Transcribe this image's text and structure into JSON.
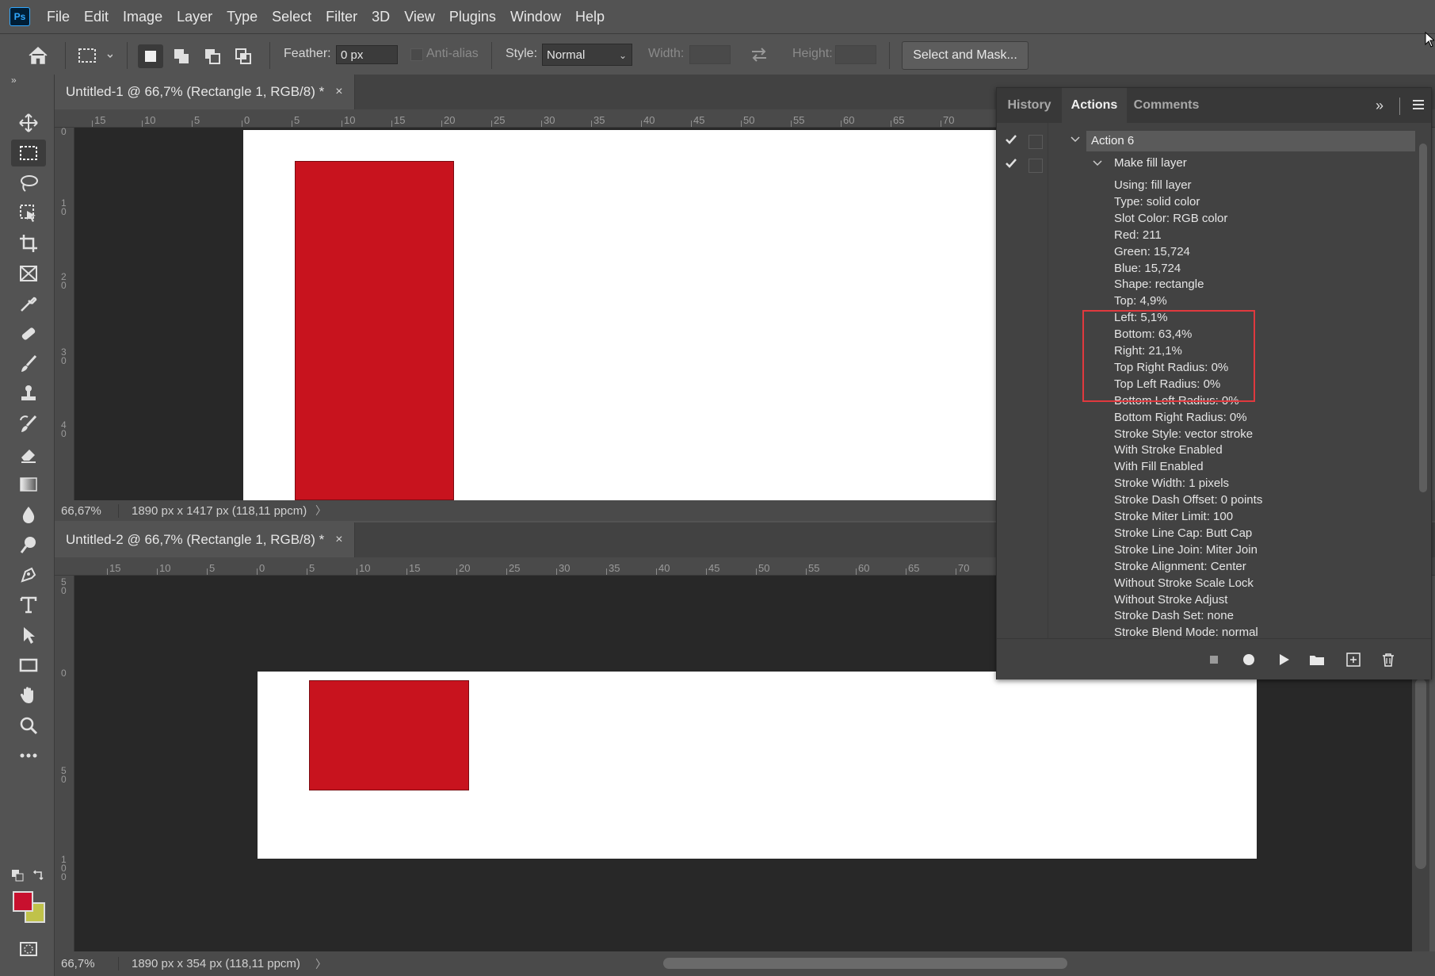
{
  "app": {
    "logo": "Ps"
  },
  "menu": [
    "File",
    "Edit",
    "Image",
    "Layer",
    "Type",
    "Select",
    "Filter",
    "3D",
    "View",
    "Plugins",
    "Window",
    "Help"
  ],
  "options": {
    "feather_label": "Feather:",
    "feather_value": "0 px",
    "antialias_label": "Anti-alias",
    "style_label": "Style:",
    "style_value": "Normal",
    "width_label": "Width:",
    "height_label": "Height:",
    "select_mask_label": "Select and Mask..."
  },
  "colors": {
    "foreground": "#c8102e",
    "background": "#c0c24a",
    "canvas_shape": "#c8131e"
  },
  "doc1": {
    "tab_title": "Untitled-1 @ 66,7% (Rectangle 1, RGB/8) *",
    "close": "×",
    "zoom": "66,67%",
    "dims": "1890 px x 1417 px (118,11 ppcm)",
    "ruler_h": [
      "15",
      "10",
      "5",
      "0",
      "5",
      "10",
      "15",
      "20",
      "25",
      "30",
      "35",
      "40",
      "45",
      "50",
      "55",
      "60",
      "65",
      "70"
    ],
    "ruler_v": [
      "0",
      "1\n0",
      "2\n0",
      "3\n0",
      "4\n0"
    ]
  },
  "doc2": {
    "tab_title": "Untitled-2 @ 66,7% (Rectangle 1, RGB/8) *",
    "close": "×",
    "zoom": "66,7%",
    "dims": "1890 px x 354 px (118,11 ppcm)",
    "ruler_h": [
      "15",
      "10",
      "5",
      "0",
      "5",
      "10",
      "15",
      "20",
      "25",
      "30",
      "35",
      "40",
      "45",
      "50",
      "55",
      "60",
      "65",
      "70"
    ],
    "ruler_v": [
      "5\n0",
      "0",
      "5\n0",
      "1\n0\n0"
    ]
  },
  "panel": {
    "tabs": [
      "History",
      "Actions",
      "Comments"
    ],
    "expand": "»",
    "action_name": "Action 6",
    "step_name": "Make fill layer",
    "lines": [
      "Using: fill layer",
      "Type: solid color",
      "Slot Color: RGB color",
      "Red: 211",
      "Green: 15,724",
      "Blue: 15,724",
      "Shape: rectangle",
      "Top: 4,9%",
      "Left: 5,1%",
      "Bottom: 63,4%",
      "Right: 21,1%",
      "Top Right Radius: 0%",
      "Top Left Radius: 0%",
      "Bottom Left Radius: 0%",
      "Bottom Right Radius: 0%",
      "Stroke Style: vector stroke",
      "With Stroke Enabled",
      "With Fill Enabled",
      "Stroke Width: 1 pixels",
      "Stroke Dash Offset: 0 points",
      "Stroke Miter Limit: 100",
      "Stroke Line Cap: Butt Cap",
      "Stroke Line Join: Miter Join",
      "Stroke Alignment: Center",
      "Without Stroke Scale Lock",
      "Without Stroke Adjust",
      "Stroke Dash Set: none",
      "Stroke Blend Mode: normal"
    ]
  }
}
